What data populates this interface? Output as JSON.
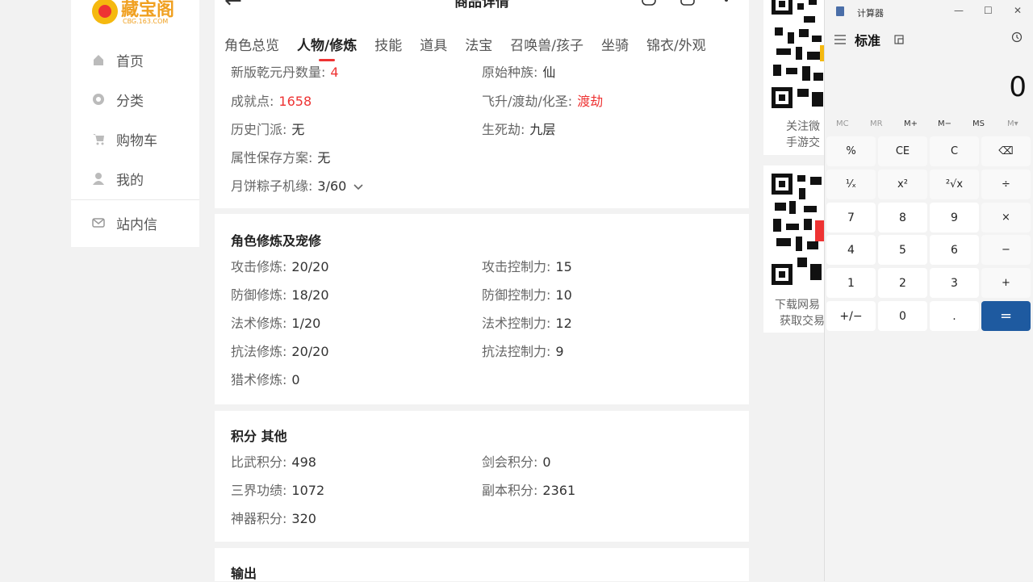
{
  "sidebar": {
    "logo_text": "藏宝阁",
    "logo_sub": "CBG.163.COM",
    "items": [
      {
        "label": "首页",
        "icon": "home-icon"
      },
      {
        "label": "分类",
        "icon": "category-icon"
      },
      {
        "label": "购物车",
        "icon": "cart-icon"
      },
      {
        "label": "我的",
        "icon": "user-icon"
      },
      {
        "label": "站内信",
        "icon": "mail-icon"
      }
    ]
  },
  "header": {
    "title": "商品详情",
    "tabs": [
      "角色总览",
      "人物/修炼",
      "技能",
      "道具",
      "法宝",
      "召唤兽/孩子",
      "坐骑",
      "锦衣/外观"
    ],
    "active_tab": "人物/修炼"
  },
  "basic": {
    "xinban_label": "新版乾元丹数量:",
    "xinban_value": "4",
    "yuanshi_label": "原始种族:",
    "yuanshi_value": "仙",
    "chengjiu_label": "成就点:",
    "chengjiu_value": "1658",
    "feisheng_label": "飞升/渡劫/化圣:",
    "feisheng_value": "渡劫",
    "lishi_label": "历史门派:",
    "lishi_value": "无",
    "shengsi_label": "生死劫:",
    "shengsi_value": "九层",
    "shuxing_label": "属性保存方案:",
    "shuxing_value": "无",
    "yuebing_label": "月饼粽子机缘:",
    "yuebing_value": "3/60"
  },
  "cultivation": {
    "title": "角色修炼及宠修",
    "left": [
      {
        "label": "攻击修炼:",
        "value": "20/20"
      },
      {
        "label": "防御修炼:",
        "value": "18/20"
      },
      {
        "label": "法术修炼:",
        "value": "1/20"
      },
      {
        "label": "抗法修炼:",
        "value": "20/20"
      },
      {
        "label": "猎术修炼:",
        "value": "0"
      }
    ],
    "right": [
      {
        "label": "攻击控制力:",
        "value": "15"
      },
      {
        "label": "防御控制力:",
        "value": "10"
      },
      {
        "label": "法术控制力:",
        "value": "12"
      },
      {
        "label": "抗法控制力:",
        "value": "9"
      }
    ]
  },
  "points": {
    "title": "积分 其他",
    "left": [
      {
        "label": "比武积分:",
        "value": "498"
      },
      {
        "label": "三界功绩:",
        "value": "1072"
      },
      {
        "label": "神器积分:",
        "value": "320"
      }
    ],
    "right": [
      {
        "label": "剑会积分:",
        "value": "0"
      },
      {
        "label": "副本积分:",
        "value": "2361"
      }
    ]
  },
  "output": {
    "title": "输出"
  },
  "qr": {
    "card1_line1": "关注微",
    "card1_line2": "手游交",
    "card2_line1": "下载网易",
    "card2_line2": "获取交易"
  },
  "calculator": {
    "window_title": "计算器",
    "mode": "标准",
    "display": "0",
    "memory": [
      "MC",
      "MR",
      "M+",
      "M−",
      "MS",
      "M▾"
    ],
    "keys": [
      [
        "%",
        "CE",
        "C",
        "⌫"
      ],
      [
        "¹⁄ₓ",
        "x²",
        "²√x",
        "÷"
      ],
      [
        "7",
        "8",
        "9",
        "×"
      ],
      [
        "4",
        "5",
        "6",
        "−"
      ],
      [
        "1",
        "2",
        "3",
        "+"
      ],
      [
        "+/−",
        "0",
        ".",
        "="
      ]
    ]
  },
  "colors": {
    "accent_red": "#ee3333",
    "calc_equals": "#1e5aa0"
  }
}
